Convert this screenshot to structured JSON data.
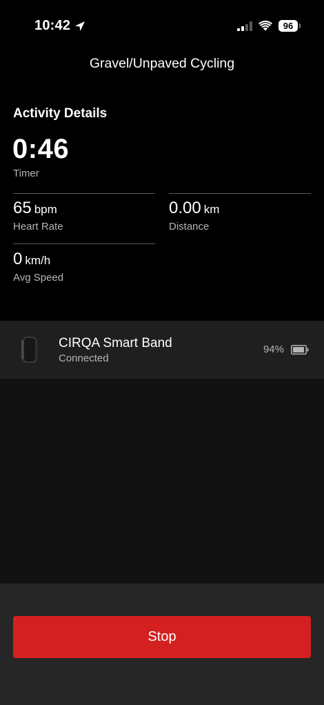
{
  "status_bar": {
    "time": "10:42",
    "battery": "96",
    "icons": [
      "location-arrow-icon",
      "cellular-signal-icon",
      "wifi-icon",
      "battery-icon"
    ]
  },
  "header": {
    "title": "Gravel/Unpaved Cycling"
  },
  "activity": {
    "heading": "Activity Details",
    "timer": {
      "value": "0:46",
      "label": "Timer"
    },
    "heart_rate": {
      "value": "65",
      "unit": "bpm",
      "label": "Heart Rate"
    },
    "distance": {
      "value": "0.00",
      "unit": "km",
      "label": "Distance"
    },
    "avg_speed": {
      "value": "0",
      "unit": "km/h",
      "label": "Avg Speed"
    }
  },
  "device": {
    "name": "CIRQA Smart Band",
    "status": "Connected",
    "battery_text": "94%",
    "battery_level": 0.94
  },
  "actions": {
    "stop_label": "Stop"
  },
  "colors": {
    "background": "#000000",
    "device_row": "#1f1f1f",
    "empty_area": "#121212",
    "bottom_panel": "#262626",
    "stop_button": "#d42020",
    "secondary_text": "#b6b6b6"
  }
}
